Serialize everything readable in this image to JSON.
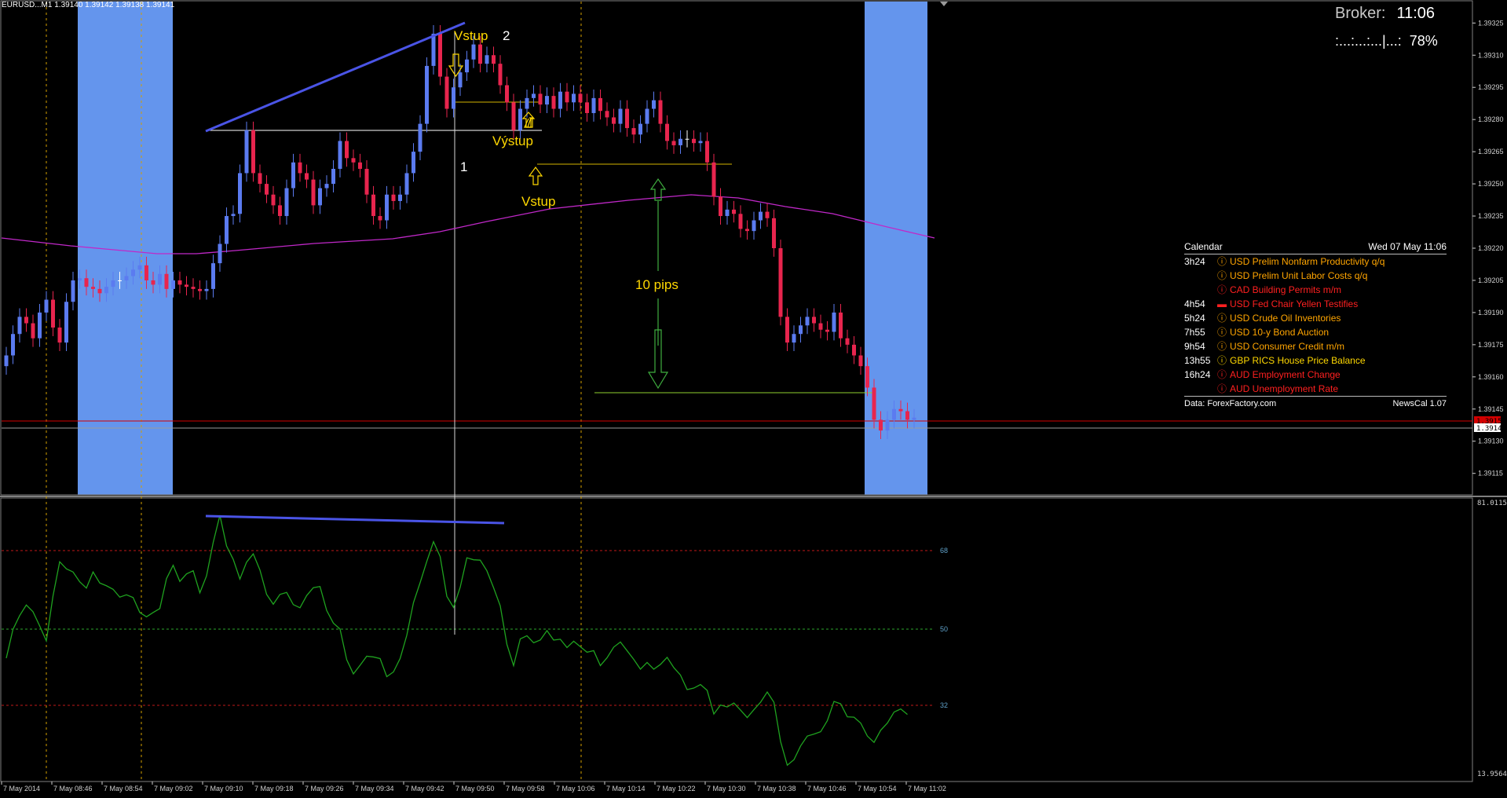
{
  "window": {
    "symbol_header": "EURUSD...M1  1.39140 1.39142 1.39138 1.39141"
  },
  "broker": {
    "label": "Broker:",
    "time": "11:06"
  },
  "progress": {
    "bar": ":...:...:...|...:",
    "percent": "78%",
    "value": 0.78
  },
  "colors": {
    "background": "#000000",
    "bull_candle": "#5b7bf0",
    "bear_candle": "#e8254e",
    "session_band": "#6495ed",
    "ma_line": "#c028c8",
    "rsi_line": "#1fa21f",
    "annotation": "#ffd800",
    "trend_line": "#4a54e6",
    "level_line": "#ffffff",
    "current_price_line": "#d40000",
    "target_line": "#8fcf2f"
  },
  "annotations": {
    "vstup_top": "Vstup",
    "label_2": "2",
    "vystup": "Výstup",
    "label_1": "1",
    "vstup_bottom": "Vstup",
    "pips": "10 pips"
  },
  "price_axis": {
    "ticks": [
      "1.39325",
      "1.39310",
      "1.39295",
      "1.39280",
      "1.39265",
      "1.39250",
      "1.39235",
      "1.39220",
      "1.39205",
      "1.39190",
      "1.39175",
      "1.39160",
      "1.39145",
      "1.39130",
      "1.39115"
    ],
    "current_price": "1.39141",
    "marker_price": "1.39150"
  },
  "rsi_axis": {
    "max": "81.0115",
    "min": "13.9564",
    "level_68": "68",
    "level_50": "50",
    "level_32": "32"
  },
  "time_axis": {
    "labels": [
      "7 May 2014",
      "7 May 08:46",
      "7 May 08:54",
      "7 May 09:02",
      "7 May 09:10",
      "7 May 09:18",
      "7 May 09:26",
      "7 May 09:34",
      "7 May 09:42",
      "7 May 09:50",
      "7 May 09:58",
      "7 May 10:06",
      "7 May 10:14",
      "7 May 10:22",
      "7 May 10:30",
      "7 May 10:38",
      "7 May 10:46",
      "7 May 10:54",
      "7 May 11:02"
    ]
  },
  "calendar": {
    "title": "Calendar",
    "date": "Wed 07 May 11:06",
    "events": [
      {
        "time": "3h24",
        "icon": "info-icon",
        "text": "USD Prelim Nonfarm Productivity q/q",
        "color": "#ffa500"
      },
      {
        "time": "",
        "icon": "info-icon",
        "text": "USD Prelim Unit Labor Costs q/q",
        "color": "#ffa500"
      },
      {
        "time": "",
        "icon": "info-icon",
        "text": "CAD Building Permits m/m",
        "color": "#ff2020"
      },
      {
        "time": "4h54",
        "icon": "speech-icon",
        "text": "USD Fed Chair Yellen Testifies",
        "color": "#ff2020"
      },
      {
        "time": "5h24",
        "icon": "info-icon",
        "text": "USD Crude Oil Inventories",
        "color": "#ffa500"
      },
      {
        "time": "7h55",
        "icon": "info-icon",
        "text": "USD 10-y Bond Auction",
        "color": "#ffa500"
      },
      {
        "time": "9h54",
        "icon": "info-icon",
        "text": "USD Consumer Credit m/m",
        "color": "#ffa500"
      },
      {
        "time": "13h55",
        "icon": "info-icon",
        "text": "GBP RICS House Price Balance",
        "color": "#ffd800"
      },
      {
        "time": "16h24",
        "icon": "info-icon",
        "text": "AUD Employment Change",
        "color": "#ff2020"
      },
      {
        "time": "",
        "icon": "info-icon",
        "text": "AUD Unemployment Rate",
        "color": "#ff2020"
      }
    ],
    "source": "Data: ForexFactory.com",
    "version": "NewsCal 1.07"
  },
  "chart_data": {
    "type": "candlestick",
    "title": "",
    "price_range": [
      1.39105,
      1.39335
    ],
    "rsi_range": [
      13.9564,
      81.0115
    ],
    "close_prices": [
      1.3917,
      1.3918,
      1.39188,
      1.39185,
      1.39178,
      1.3919,
      1.39196,
      1.39183,
      1.39176,
      1.39195,
      1.39205,
      1.39206,
      1.39202,
      1.39201,
      1.39199,
      1.39202,
      1.39205,
      1.39205,
      1.39207,
      1.3921,
      1.39212,
      1.39205,
      1.39203,
      1.39208,
      1.39201,
      1.39205,
      1.39203,
      1.39202,
      1.39201,
      1.392,
      1.39201,
      1.39213,
      1.39222,
      1.39235,
      1.39236,
      1.39255,
      1.39275,
      1.39255,
      1.3925,
      1.39245,
      1.3924,
      1.39235,
      1.39248,
      1.3926,
      1.39255,
      1.39252,
      1.3924,
      1.39248,
      1.3925,
      1.39257,
      1.3927,
      1.39262,
      1.3926,
      1.39257,
      1.39245,
      1.39235,
      1.39233,
      1.39245,
      1.39242,
      1.39245,
      1.39255,
      1.39265,
      1.39278,
      1.39305,
      1.3932,
      1.393,
      1.39285,
      1.39295,
      1.39302,
      1.39308,
      1.39315,
      1.39306,
      1.3931,
      1.39306,
      1.39296,
      1.39288,
      1.39275,
      1.39285,
      1.3929,
      1.39292,
      1.39287,
      1.39291,
      1.39285,
      1.39293,
      1.39288,
      1.39292,
      1.39288,
      1.39283,
      1.3929,
      1.39284,
      1.39281,
      1.39278,
      1.39285,
      1.39276,
      1.39273,
      1.39278,
      1.39285,
      1.39289,
      1.39278,
      1.3927,
      1.39268,
      1.39271,
      1.39271,
      1.39269,
      1.3927,
      1.3926,
      1.39244,
      1.39235,
      1.39238,
      1.39236,
      1.39229,
      1.39228,
      1.39233,
      1.39237,
      1.39234,
      1.3922,
      1.39188,
      1.39176,
      1.3918,
      1.39184,
      1.39188,
      1.39185,
      1.39182,
      1.39181,
      1.3919,
      1.39178,
      1.39175,
      1.3917,
      1.39165,
      1.39155,
      1.3914,
      1.39135,
      1.3914,
      1.39145,
      1.39144,
      1.3914,
      1.39141
    ],
    "rsi_values": [
      44.7,
      52.0,
      55.5,
      58.2,
      56.5,
      52.9,
      49.1,
      60.5,
      69.2,
      67.4,
      66.6,
      64.1,
      62.5,
      66.6,
      63.8,
      63.1,
      62.2,
      60.2,
      60.8,
      60.1,
      56.3,
      55.2,
      56.3,
      57.3,
      64.9,
      68.3,
      64.2,
      66.1,
      66.9,
      61.3,
      65.6,
      74.1,
      81.0,
      73.2,
      69.8,
      64.8,
      69.1,
      71.2,
      67.1,
      60.9,
      58.4,
      60.9,
      61.4,
      58.3,
      57.5,
      60.6,
      62.6,
      62.9,
      56.8,
      53.6,
      52.1,
      44.3,
      40.7,
      42.9,
      45.2,
      45.0,
      44.6,
      40.0,
      41.2,
      44.6,
      50.5,
      58.8,
      63.9,
      69.3,
      74.3,
      70.5,
      60.4,
      57.6,
      62.7,
      70.2,
      69.7,
      69.6,
      66.9,
      62.6,
      58.0,
      48.2,
      42.8,
      49.6,
      50.4,
      48.6,
      49.3,
      51.7,
      49.3,
      49.5,
      47.4,
      49.0,
      47.6,
      46.2,
      46.6,
      42.8,
      44.8,
      47.5,
      48.8,
      46.6,
      44.4,
      41.9,
      43.6,
      41.9,
      43.1,
      44.9,
      42.3,
      40.4,
      36.7,
      37.1,
      38.0,
      36.5,
      30.5,
      32.8,
      32.3,
      33.3,
      31.5,
      29.6,
      31.6,
      33.5,
      36.1,
      33.5,
      23.5,
      17.5,
      18.9,
      22.4,
      24.9,
      25.4,
      26.0,
      28.8,
      33.7,
      33.1,
      29.8,
      29.7,
      28.2,
      24.9,
      23.3,
      26.4,
      28.2,
      31.0,
      31.8,
      30.4
    ]
  }
}
